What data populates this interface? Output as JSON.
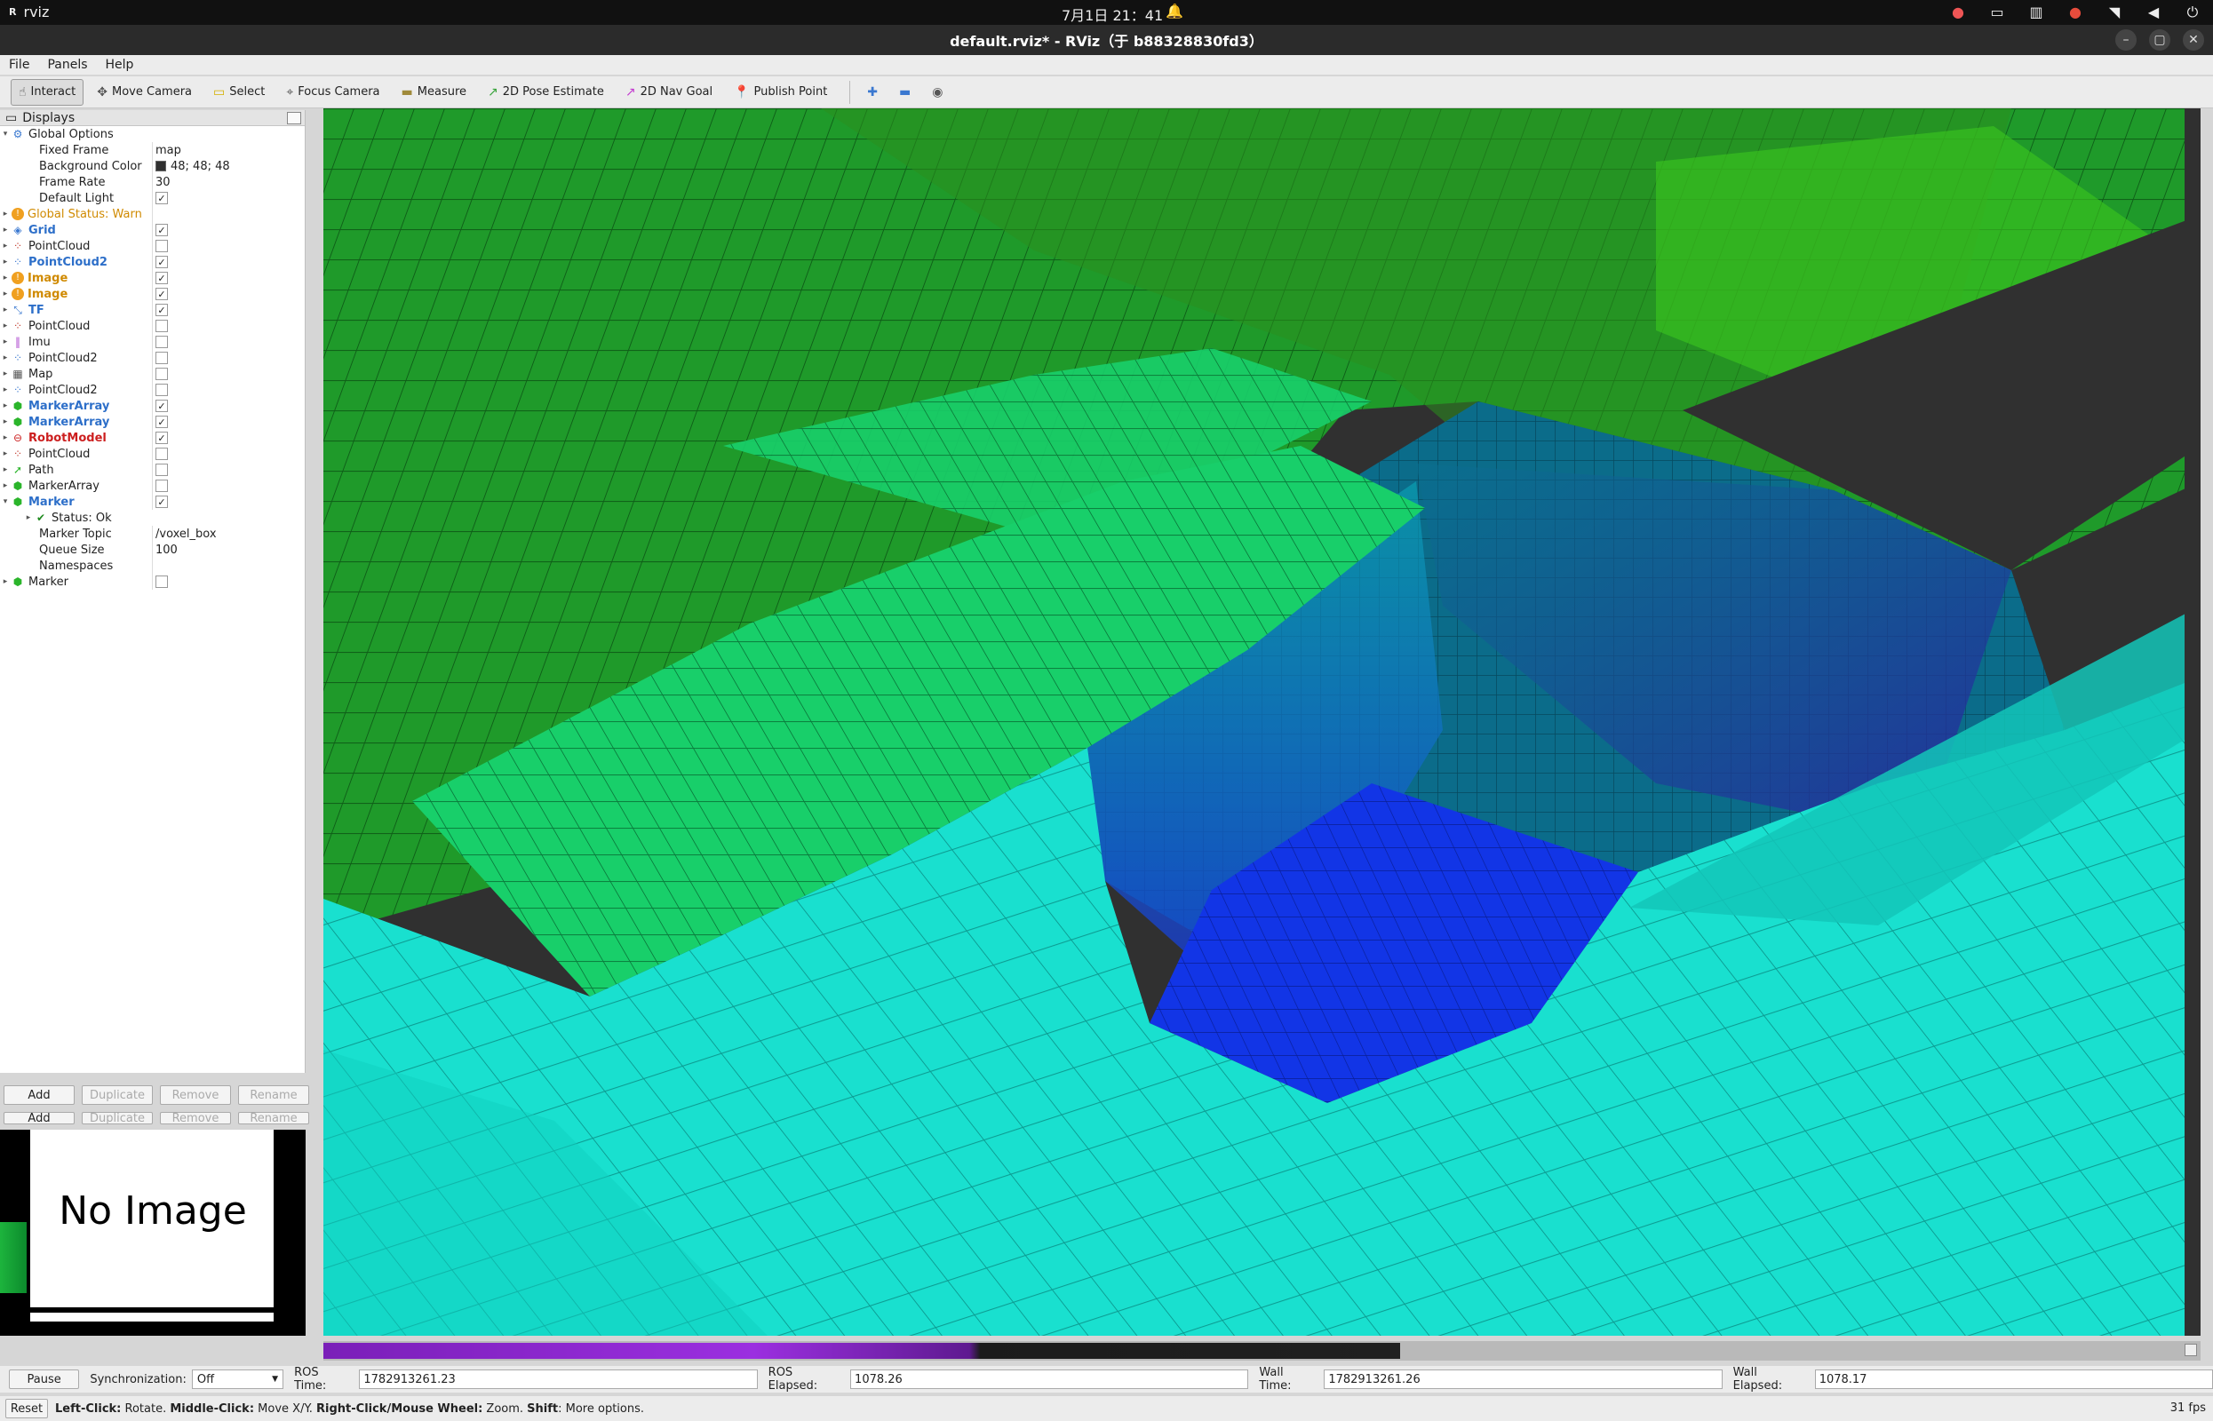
{
  "system": {
    "app_name": "rviz",
    "clock": "7月1日  21：41"
  },
  "window": {
    "title": "default.rviz* - RViz（于 b88328830fd3）"
  },
  "menu": [
    "File",
    "Panels",
    "Help"
  ],
  "toolbar": [
    {
      "label": "Interact",
      "icon": "cursor-icon",
      "active": true
    },
    {
      "label": "Move Camera",
      "icon": "move-camera-icon"
    },
    {
      "label": "Select",
      "icon": "select-icon"
    },
    {
      "label": "Focus Camera",
      "icon": "focus-camera-icon"
    },
    {
      "label": "Measure",
      "icon": "measure-icon"
    },
    {
      "label": "2D Pose Estimate",
      "icon": "pose-estimate-icon"
    },
    {
      "label": "2D Nav Goal",
      "icon": "nav-goal-icon"
    },
    {
      "label": "Publish Point",
      "icon": "publish-point-icon"
    }
  ],
  "displays": {
    "title": "Displays",
    "global_options": {
      "label": "Global Options",
      "fixed_frame_label": "Fixed Frame",
      "fixed_frame": "map",
      "bg_color_label": "Background Color",
      "bg_color": "48; 48; 48",
      "frame_rate_label": "Frame Rate",
      "frame_rate": "30",
      "default_light_label": "Default Light"
    },
    "items": [
      {
        "name": "Global Status: Warn",
        "style": "orange",
        "icon": "warn-icon",
        "check": null
      },
      {
        "name": "Grid",
        "style": "blue bold",
        "icon": "grid-icon",
        "check": true
      },
      {
        "name": "PointCloud",
        "style": "",
        "icon": "pointcloud-icon",
        "check": false
      },
      {
        "name": "PointCloud2",
        "style": "blue bold",
        "icon": "pointcloud2-icon",
        "check": true
      },
      {
        "name": "Image",
        "style": "orange bold",
        "icon": "warn-icon",
        "check": true
      },
      {
        "name": "Image",
        "style": "orange bold",
        "icon": "warn-icon",
        "check": true
      },
      {
        "name": "TF",
        "style": "blue bold",
        "icon": "tf-icon",
        "check": true
      },
      {
        "name": "PointCloud",
        "style": "",
        "icon": "pointcloud-icon",
        "check": false
      },
      {
        "name": "Imu",
        "style": "",
        "icon": "imu-icon",
        "check": false
      },
      {
        "name": "PointCloud2",
        "style": "",
        "icon": "pointcloud2-icon",
        "check": false
      },
      {
        "name": "Map",
        "style": "",
        "icon": "map-icon",
        "check": false
      },
      {
        "name": "PointCloud2",
        "style": "",
        "icon": "pointcloud2-icon",
        "check": false
      },
      {
        "name": "MarkerArray",
        "style": "blue bold",
        "icon": "markerarray-icon",
        "check": true
      },
      {
        "name": "MarkerArray",
        "style": "blue bold",
        "icon": "markerarray-icon",
        "check": true
      },
      {
        "name": "RobotModel",
        "style": "red bold",
        "icon": "error-icon",
        "check": true
      },
      {
        "name": "PointCloud",
        "style": "",
        "icon": "pointcloud-icon",
        "check": false
      },
      {
        "name": "Path",
        "style": "",
        "icon": "path-icon",
        "check": false
      },
      {
        "name": "MarkerArray",
        "style": "",
        "icon": "markerarray-icon",
        "check": false
      }
    ],
    "marker": {
      "name": "Marker",
      "status_label": "Status: Ok",
      "topic_label": "Marker Topic",
      "topic": "/voxel_box",
      "queue_label": "Queue Size",
      "queue": "100",
      "namespaces_label": "Namespaces"
    },
    "last_marker": "Marker",
    "buttons": {
      "add": "Add",
      "duplicate": "Duplicate",
      "remove": "Remove",
      "rename": "Rename"
    }
  },
  "image_panel": {
    "text": "No Image"
  },
  "timebar": {
    "pause": "Pause",
    "sync_label": "Synchronization:",
    "sync_value": "Off",
    "ros_time_label": "ROS Time:",
    "ros_time": "1782913261.23",
    "ros_elapsed_label": "ROS Elapsed:",
    "ros_elapsed": "1078.26",
    "wall_time_label": "Wall Time:",
    "wall_time": "1782913261.26",
    "wall_elapsed_label": "Wall Elapsed:",
    "wall_elapsed": "1078.17"
  },
  "statusbar": {
    "reset": "Reset",
    "left_click": "Left-Click:",
    "left_click_desc": " Rotate. ",
    "middle_click": "Middle-Click:",
    "middle_click_desc": " Move X/Y. ",
    "right_click": "Right-Click/Mouse Wheel:",
    "right_click_desc": " Zoom. ",
    "shift": "Shift",
    "shift_desc": ": More options.",
    "fps": "31 fps"
  },
  "colors": {
    "background": "#303030",
    "voxel_top": "#1fa82f",
    "voxel_mid": "#00e0a0",
    "voxel_cyan": "#19e6d6",
    "voxel_bottom": "#1236e8"
  }
}
